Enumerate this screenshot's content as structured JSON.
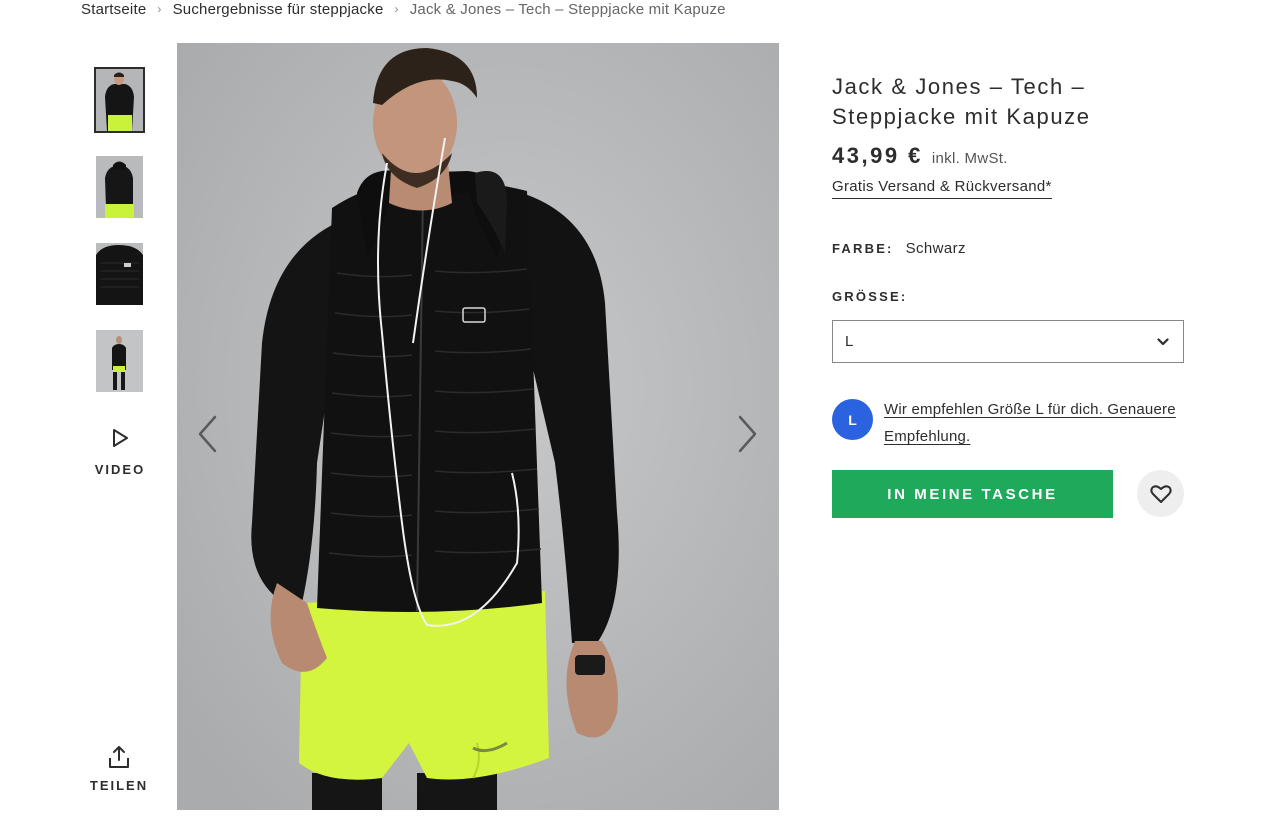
{
  "breadcrumb": {
    "items": [
      "Startseite",
      "Suchergebnisse für steppjacke"
    ],
    "current": "Jack & Jones – Tech – Steppjacke mit Kapuze",
    "separator": "›"
  },
  "gallery": {
    "thumbnail_count": 4,
    "active_thumbnail": 1,
    "video_label": "VIDEO",
    "share_label": "TEILEN",
    "prev_icon": "chevron-left-icon",
    "next_icon": "chevron-right-icon"
  },
  "product": {
    "title": "Jack & Jones – Tech – Steppjacke mit Kapuze",
    "price": "43,99 €",
    "vat_note": "inkl. MwSt.",
    "shipping": "Gratis Versand & Rückversand*",
    "color_label": "FARBE:",
    "color_value": "Schwarz",
    "size_label": "GRÖSSE:",
    "size_value": "L",
    "recommendation_badge": "L",
    "recommendation_text": "Wir empfehlen Größe L für dich. Genauere Empfehlung.",
    "add_to_bag": "IN MEINE TASCHE"
  },
  "colors": {
    "accent_green": "#1ea95b",
    "badge_blue": "#2a62e0",
    "text": "#2d2d2d",
    "wishlist_bg": "#eeeeee"
  }
}
